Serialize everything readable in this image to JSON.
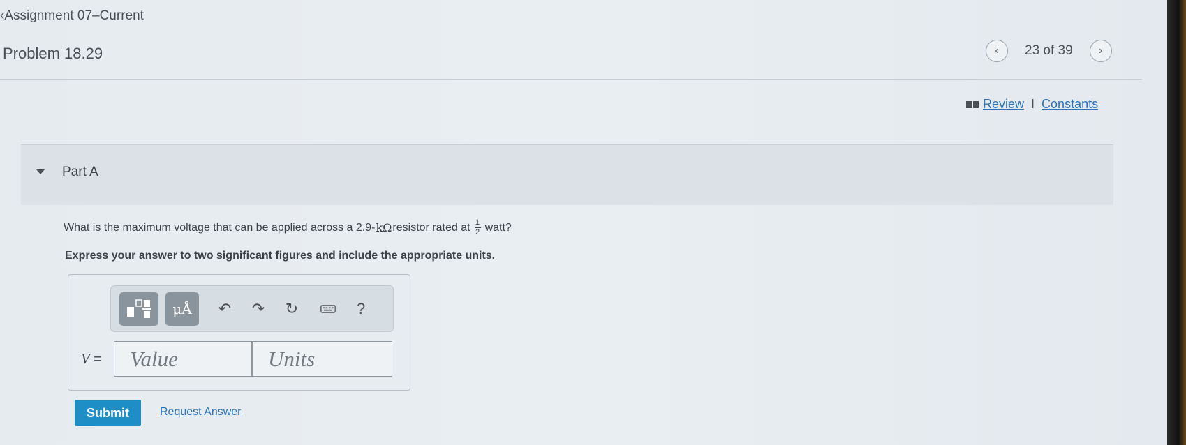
{
  "header": {
    "back_label": "Assignment 07–Current",
    "problem_title": "Problem 18.29",
    "pager": {
      "text": "23 of 39",
      "prev_icon": "chevron-left-icon",
      "next_icon": "chevron-right-icon"
    }
  },
  "resources": {
    "review_label": "Review",
    "separator": "I",
    "constants_label": "Constants"
  },
  "part": {
    "title": "Part A",
    "question_prefix": "What is the maximum voltage that can be applied across a 2.9-",
    "question_unit": "kΩ",
    "question_middle": " resistor rated at",
    "fraction_numerator": "1",
    "fraction_denominator": "2",
    "question_suffix": "watt?",
    "instruction": "Express your answer to two significant figures and include the appropriate units."
  },
  "toolbar": {
    "units_button_label": "μÅ",
    "help_label": "?"
  },
  "answer": {
    "variable": "V",
    "equals": "=",
    "value_placeholder": "Value",
    "units_placeholder": "Units"
  },
  "actions": {
    "submit_label": "Submit",
    "request_answer_label": "Request Answer"
  },
  "colors": {
    "accent": "#1e8ec7",
    "link": "#2a73b8",
    "toolbar_button": "#8a949c"
  }
}
